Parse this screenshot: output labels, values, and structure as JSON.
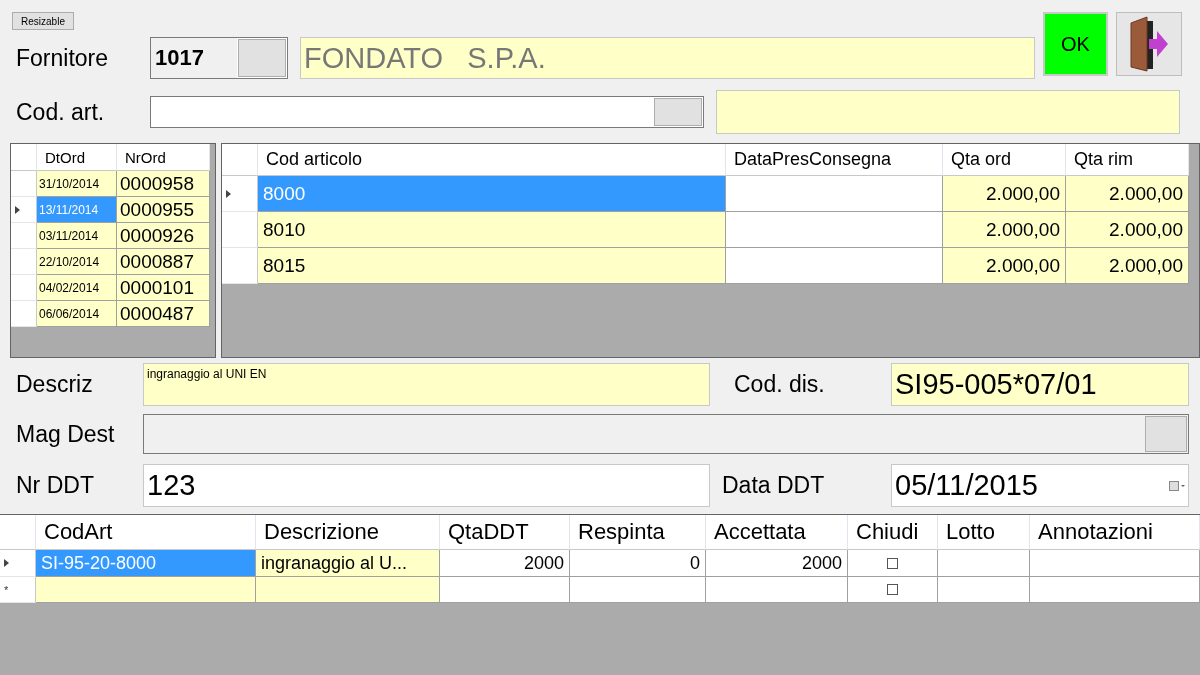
{
  "resize_button": "Resizable",
  "supplier": {
    "label": "Fornitore",
    "code": "1017",
    "name": "FONDATO   S.P.A."
  },
  "ok_button": "OK",
  "article": {
    "label": "Cod. art."
  },
  "orders": {
    "columns": [
      "DtOrd",
      "NrOrd"
    ],
    "rows": [
      {
        "date": "31/10/2014",
        "number": "0000958",
        "selected": false
      },
      {
        "date": "13/11/2014",
        "number": "0000955",
        "selected": true
      },
      {
        "date": "03/11/2014",
        "number": "0000926",
        "selected": false
      },
      {
        "date": "22/10/2014",
        "number": "0000887",
        "selected": false
      },
      {
        "date": "04/02/2014",
        "number": "0000101",
        "selected": false
      },
      {
        "date": "06/06/2014",
        "number": "0000487",
        "selected": false
      }
    ]
  },
  "order_lines": {
    "columns": [
      "Cod articolo",
      "DataPresConsegna",
      "Qta ord",
      "Qta rim"
    ],
    "rows": [
      {
        "code": "8000",
        "qty_ord": "2.000,00",
        "qty_rim": "2.000,00",
        "selected": true
      },
      {
        "code": "8010",
        "qty_ord": "2.000,00",
        "qty_rim": "2.000,00",
        "selected": false
      },
      {
        "code": "8015",
        "qty_ord": "2.000,00",
        "qty_rim": "2.000,00",
        "selected": false
      }
    ]
  },
  "description": {
    "label": "Descriz",
    "value": "ingranaggio al UNI EN"
  },
  "drawing_code": {
    "label": "Cod. dis.",
    "value": "SI95-005*07/01"
  },
  "warehouse": {
    "label": "Mag Dest"
  },
  "ddt_number": {
    "label": "Nr DDT",
    "value": "123"
  },
  "ddt_date": {
    "label": "Data DDT",
    "value": "05/11/2015"
  },
  "ddt_lines": {
    "columns": [
      "CodArt",
      "Descrizione",
      "QtaDDT",
      "Respinta",
      "Accettata",
      "Chiudi",
      "Lotto",
      "Annotazioni"
    ],
    "rows": [
      {
        "kind": "item",
        "cod_art": "SI-95-20-8000",
        "descrizione": "ingranaggio al U...",
        "qta_ddt": "2000",
        "respinta": "0",
        "accettata": "2000",
        "chiudi": false,
        "selected": true
      },
      {
        "kind": "new",
        "marker": "*",
        "chiudi": false,
        "selected": false
      }
    ]
  }
}
